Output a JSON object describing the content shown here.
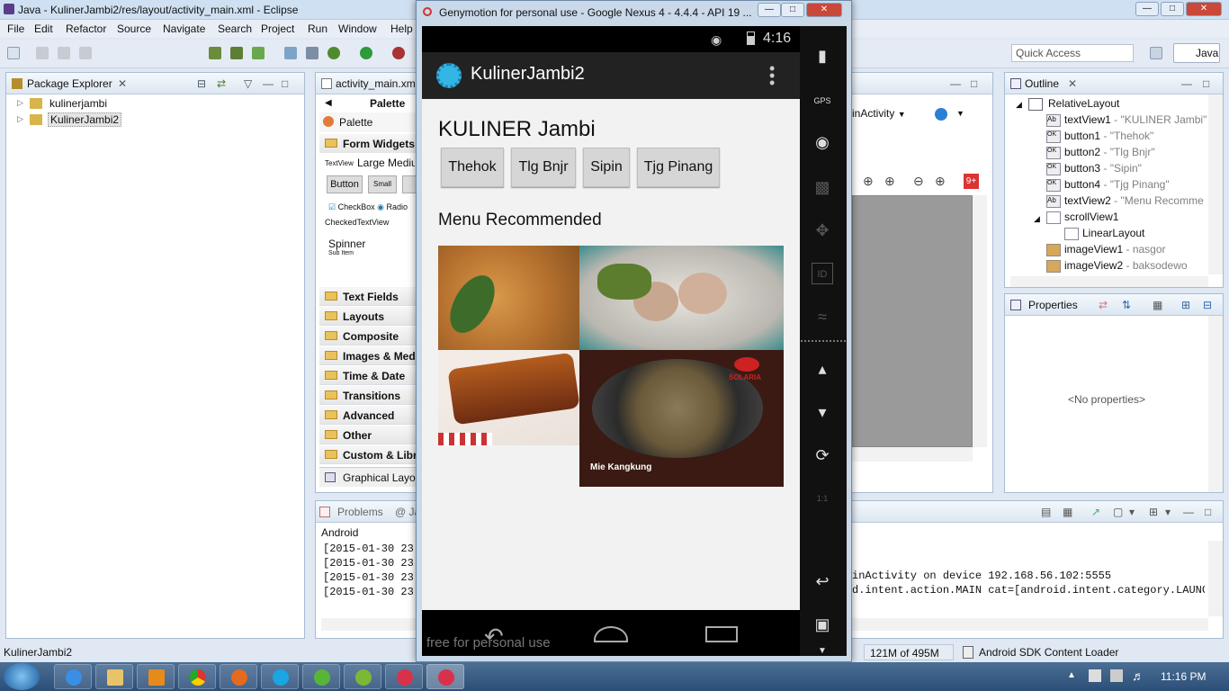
{
  "eclipse": {
    "title": "Java - KulinerJambi2/res/layout/activity_main.xml - Eclipse",
    "menu": [
      "File",
      "Edit",
      "Refactor",
      "Source",
      "Navigate",
      "Search",
      "Project",
      "Run",
      "Window",
      "Help"
    ],
    "quick_access_placeholder": "Quick Access",
    "perspective": "Java",
    "package_explorer": {
      "tab": "Package Explorer",
      "items": [
        "kulinerjambi",
        "KulinerJambi2"
      ]
    },
    "editor_tab": "activity_main.xml",
    "palette": {
      "title": "Palette",
      "header": "Palette",
      "form_widgets": "Form Widgets",
      "textview_label": "TextView",
      "textview_sizes": "Large Mediu",
      "button": "Button",
      "small": "Small",
      "checkbox": "CheckBox",
      "radio": "Radio",
      "checkedtextview": "CheckedTextView",
      "spinner": "Spinner",
      "sub_item": "Sub Item",
      "categories": [
        "Text Fields",
        "Layouts",
        "Composite",
        "Images & Med",
        "Time & Date",
        "Transitions",
        "Advanced",
        "Other",
        "Custom & Libr"
      ],
      "graphical_layout": "Graphical Layou"
    },
    "designer": {
      "activity_selector": "inActivity",
      "badge": "9+"
    },
    "outline": {
      "tab": "Outline",
      "nodes": [
        {
          "name": "RelativeLayout",
          "detail": ""
        },
        {
          "name": "textView1",
          "detail": " - \"KULINER Jambi\""
        },
        {
          "name": "button1",
          "detail": " - \"Thehok\""
        },
        {
          "name": "button2",
          "detail": " - \"Tlg Bnjr\""
        },
        {
          "name": "button3",
          "detail": " - \"Sipin\""
        },
        {
          "name": "button4",
          "detail": " - \"Tjg Pinang\""
        },
        {
          "name": "textView2",
          "detail": " - \"Menu Recomme"
        },
        {
          "name": "scrollView1",
          "detail": ""
        },
        {
          "name": "LinearLayout",
          "detail": ""
        },
        {
          "name": "imageView1",
          "detail": " - nasgor"
        },
        {
          "name": "imageView2",
          "detail": " - baksodewo"
        }
      ]
    },
    "properties": {
      "tab": "Properties",
      "empty": "<No properties>"
    },
    "problems": {
      "tab": "Problems",
      "tab2": "@ Ja",
      "console_name": "Android",
      "lines": [
        "[2015-01-30 23:",
        "[2015-01-30 23:",
        "[2015-01-30 23:",
        "[2015-01-30 23:"
      ],
      "right_lines": [
        "inActivity on device 192.168.56.102:5555",
        "d.intent.action.MAIN cat=[android.intent.category.LAUNCH"
      ]
    },
    "status": {
      "left": "KulinerJambi2",
      "memory": "121M of 495M",
      "loader": "Android SDK Content Loader"
    }
  },
  "genymotion": {
    "title": "Genymotion for personal use - Google Nexus 4 - 4.4.4 - API 19 ...",
    "watermark": "free for personal use",
    "status_time": "4:16",
    "gps_label": "GPS",
    "id_label": "ID",
    "scale_label": "1:1",
    "app": {
      "title": "KulinerJambi2",
      "heading": "KULINER Jambi",
      "buttons": [
        "Thehok",
        "Tlg Bnjr",
        "Sipin",
        "Tjg Pinang"
      ],
      "section": "Menu Recommended",
      "caption": "Mie Kangkung",
      "caption_brand": "SOLARIA"
    }
  },
  "taskbar": {
    "time": "11:16 PM"
  },
  "colors": {
    "action_bar": "#222222",
    "accent": "#33b5e5",
    "panel_border": "#a9bcd2"
  }
}
